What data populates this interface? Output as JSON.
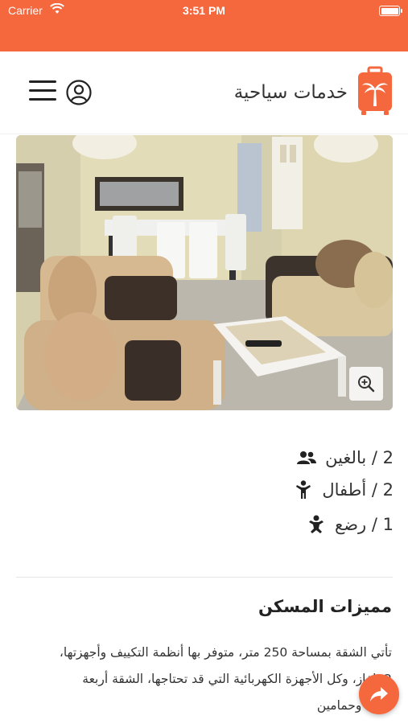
{
  "status_bar": {
    "carrier": "Carrier",
    "time": "3:51 PM"
  },
  "header": {
    "brand_title": "خدمات سياحية",
    "menu_icon": "hamburger-menu-icon",
    "account_icon": "user-circle-icon",
    "logo_icon": "palm-suitcase-logo"
  },
  "colors": {
    "accent": "#f5673d",
    "text": "#222222"
  },
  "photo": {
    "zoom_icon": "zoom-in-icon"
  },
  "occupancy": [
    {
      "text": "2 / بالغين",
      "icon": "users-icon"
    },
    {
      "text": "2 / أطفال",
      "icon": "child-icon"
    },
    {
      "text": "1 / رضع",
      "icon": "baby-icon"
    }
  ],
  "features": {
    "title": "مميزات المسكن",
    "lines": [
      "تأتي الشقة بمساحة 250 متر، متوفر بها أنظمة التكييف وأجهزتها،",
      "2 تلفاز، وكل الأجهزة الكهربائية التي قد تحتاجها، الشقة أربعة",
      "غرف وحمامين"
    ]
  },
  "share": {
    "icon": "share-arrow-icon"
  }
}
